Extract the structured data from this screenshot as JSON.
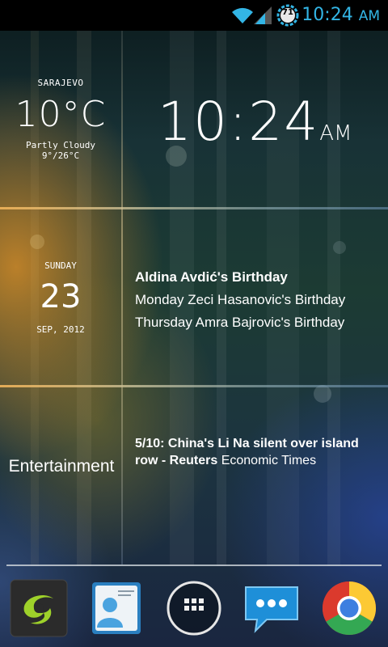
{
  "status_bar": {
    "battery_level": "71",
    "time": "10:24",
    "ampm": "AM",
    "icons": [
      "wifi-icon",
      "signal-icon",
      "battery-icon"
    ],
    "accent_color": "#33b5e5"
  },
  "weather": {
    "city": "SARAJEVO",
    "temperature": "10°C",
    "condition": "Partly Cloudy",
    "range": "9°/26°C"
  },
  "clock": {
    "time": "10:24",
    "ampm": "AM"
  },
  "date": {
    "day_name": "SUNDAY",
    "day_number": "23",
    "month_year": "SEP, 2012"
  },
  "events": [
    "Aldina Avdić's Birthday",
    "Monday Zeci Hasanovic's Birthday",
    "Thursday Amra Bajrovic's Birthday"
  ],
  "news": {
    "category": "Entertainment",
    "headline": "5/10: China's Li Na silent over island row - Reuters",
    "source": "Economic Times"
  },
  "dock": {
    "apps": [
      "app-icon",
      "contacts-icon",
      "app-drawer-icon",
      "messaging-icon",
      "chrome-icon"
    ]
  }
}
